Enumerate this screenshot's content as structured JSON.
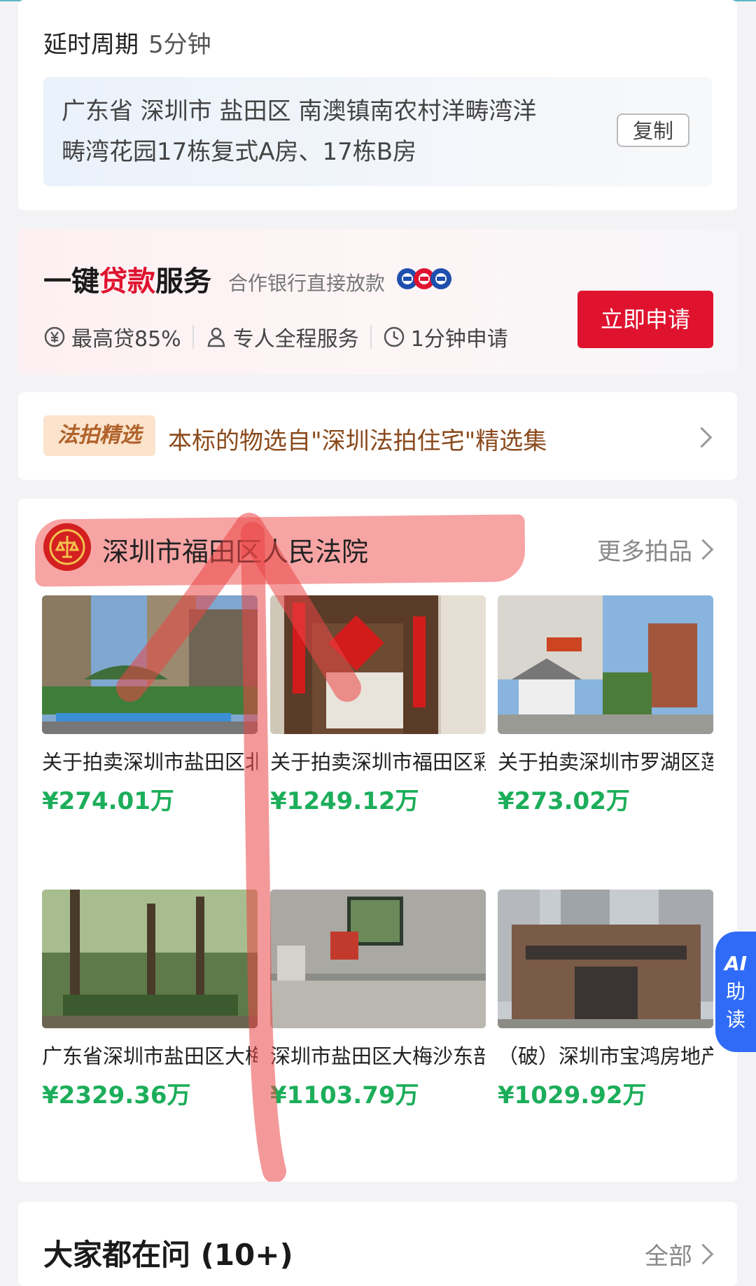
{
  "delay": {
    "label": "延时周期",
    "value": "5分钟"
  },
  "address": {
    "text": "广东省 深圳市 盐田区 南澳镇南农村洋畴湾洋畴湾花园17栋复式A房、17栋B房",
    "copy_label": "复制"
  },
  "loan": {
    "title_pre": "一键",
    "title_red": "贷款",
    "title_post": "服务",
    "subtitle": "合作银行直接放款",
    "features": [
      "最高贷85%",
      "专人全程服务",
      "1分钟申请"
    ],
    "apply_label": "立即申请",
    "accent_color": "#e0132f"
  },
  "selection": {
    "tag": "法拍精选",
    "text": "本标的物选自\"深圳法拍住宅\"精选集"
  },
  "court": {
    "name": "深圳市福田区人民法院",
    "more_label": "更多拍品",
    "items": [
      {
        "title": "关于拍卖深圳市盐田区北山道山海四季...",
        "price": "¥274.01万"
      },
      {
        "title": "关于拍卖深圳市福田区彩田路与福中三...",
        "price": "¥1249.12万"
      },
      {
        "title": "关于拍卖深圳市罗湖区莲塘罗沙路鹿茵...",
        "price": "¥273.02万"
      },
      {
        "title": "广东省深圳市盐田区大梅沙盐排路西南...",
        "price": "¥2329.36万"
      },
      {
        "title": "深圳市盐田区大梅沙东部华侨城天麓六...",
        "price": "¥1103.79万"
      },
      {
        "title": "（破）深圳市宝鸿房地产开发有限公司...",
        "price": "¥1029.92万"
      }
    ]
  },
  "faq": {
    "title": "大家都在问 (10+)",
    "all_label": "全部"
  },
  "ai_tab": {
    "ai": "AI",
    "zhu": "助",
    "du": "读"
  },
  "colors": {
    "price": "#1cae5a",
    "ai_tab": "#2f6bf6",
    "highlight": "#f05a5a"
  }
}
